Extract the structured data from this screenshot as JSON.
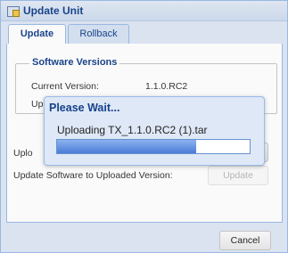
{
  "window": {
    "title": "Update Unit"
  },
  "tabs": [
    {
      "label": "Update"
    },
    {
      "label": "Rollback"
    }
  ],
  "software_versions": {
    "legend": "Software Versions",
    "current_label": "Current Version:",
    "current_value": "1.1.0.RC2",
    "second_row_label_fragment": "Up"
  },
  "upload": {
    "label_fragment": "Uplo"
  },
  "update_row": {
    "label": "Update Software to Uploaded Version:",
    "button": "Update"
  },
  "footer": {
    "cancel": "Cancel"
  },
  "dialog": {
    "title": "Please Wait...",
    "message": "Uploading TX_1.1.0.RC2 (1).tar",
    "progress": 0.72
  },
  "icons": {
    "window": "window-icon"
  }
}
